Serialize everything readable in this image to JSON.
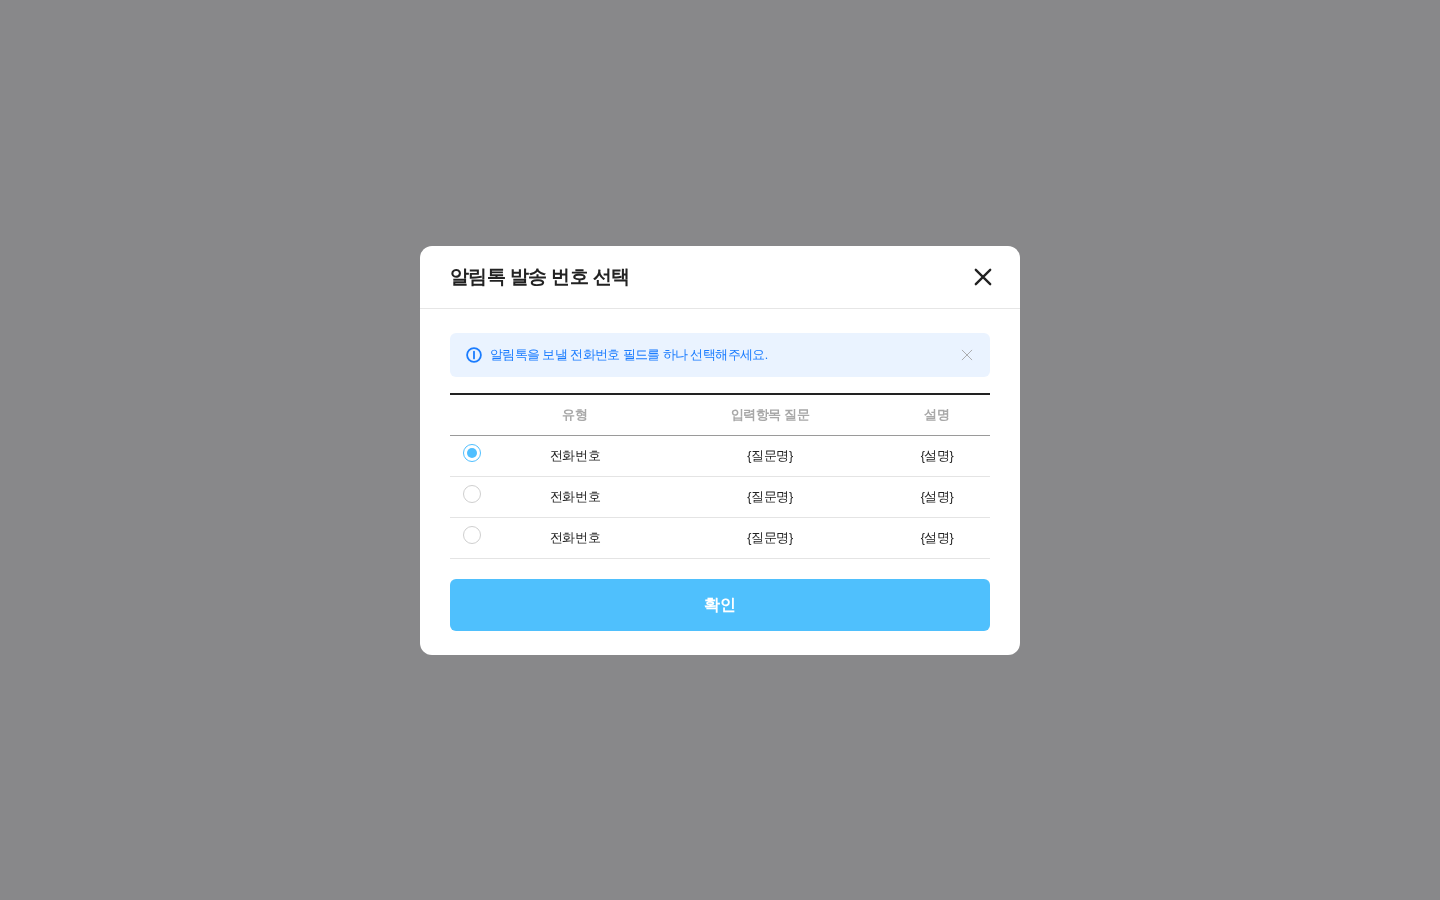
{
  "modal": {
    "title": "알림톡 발송 번호 선택"
  },
  "alert": {
    "message": "알림톡을 보낼 전화번호 필드를 하나 선택해주세요."
  },
  "table": {
    "columns": [
      "유형",
      "입력항목 질문",
      "설명"
    ],
    "rows": [
      {
        "selected": true,
        "type": "전화번호",
        "question": "{질문명}",
        "description": "{설명}"
      },
      {
        "selected": false,
        "type": "전화번호",
        "question": "{질문명}",
        "description": "{설명}"
      },
      {
        "selected": false,
        "type": "전화번호",
        "question": "{질문명}",
        "description": "{설명}"
      }
    ]
  },
  "confirm_button": {
    "label": "확인"
  }
}
